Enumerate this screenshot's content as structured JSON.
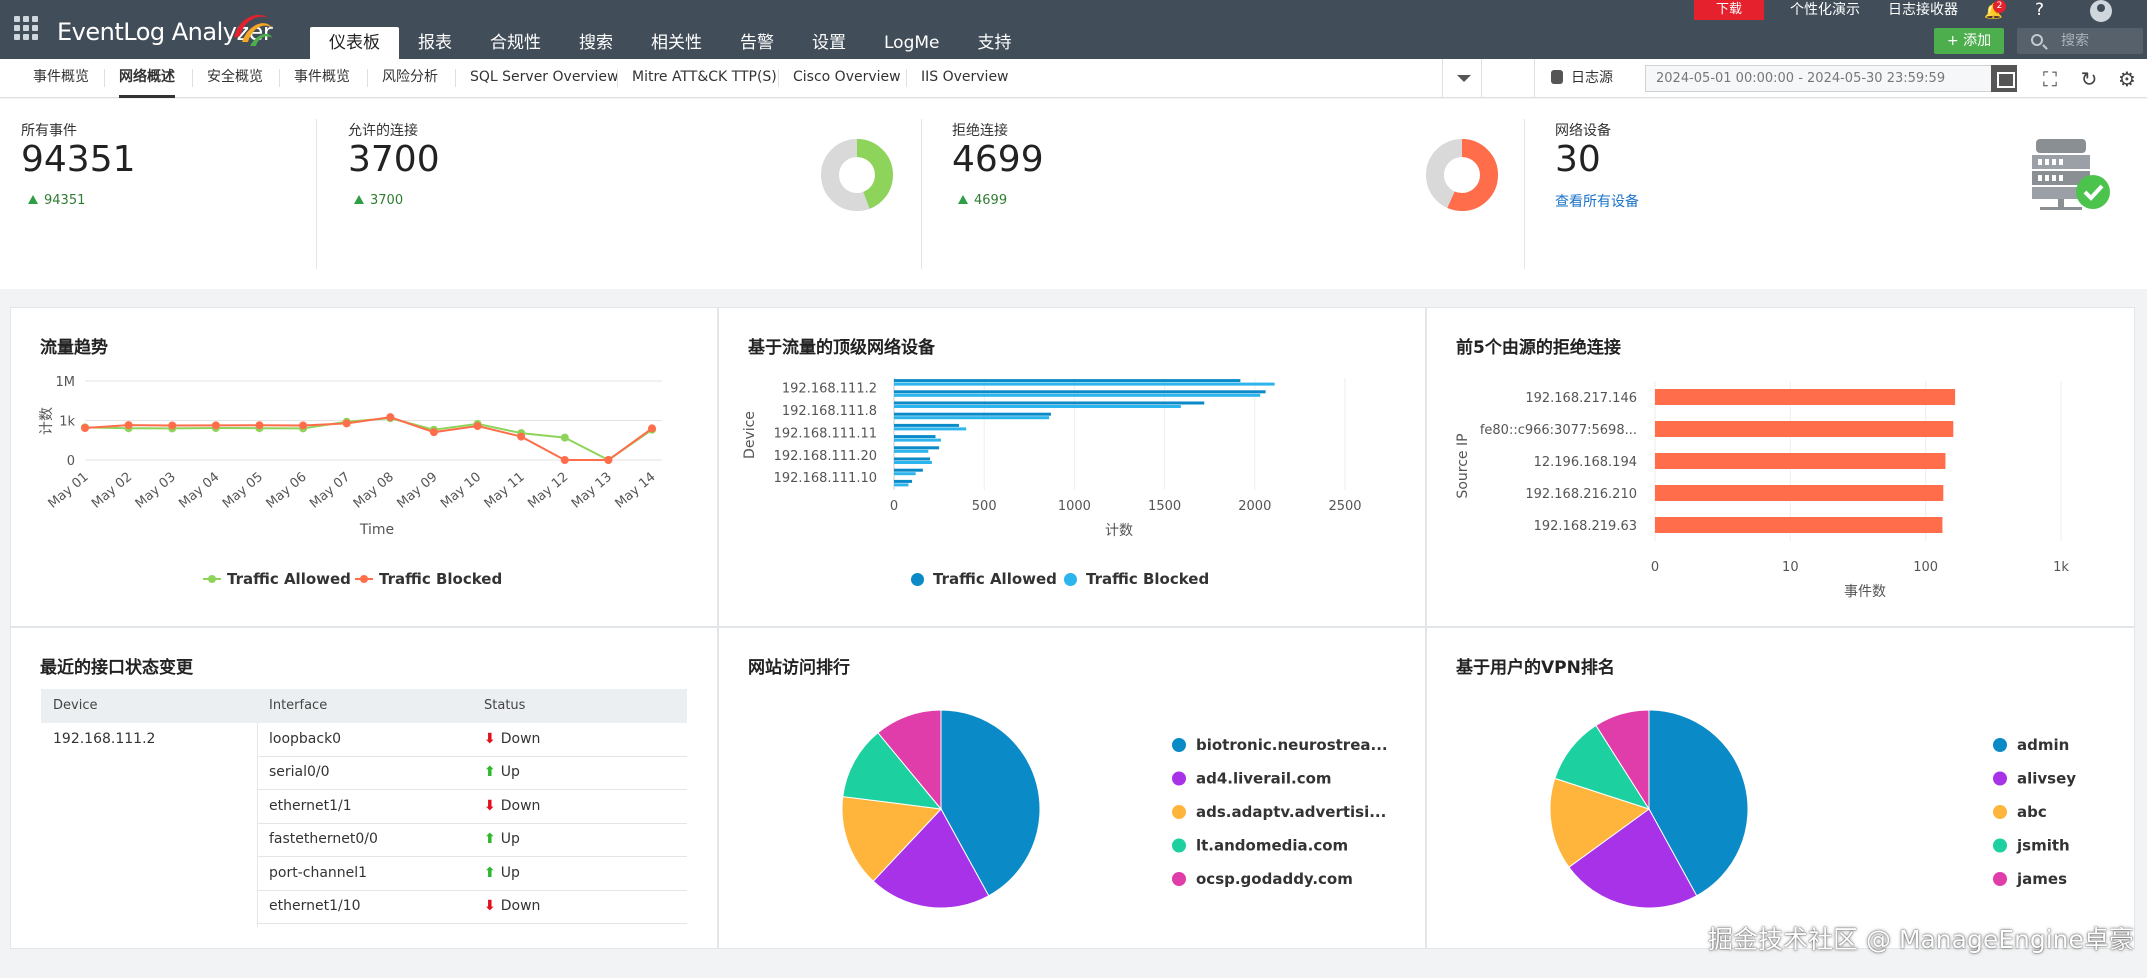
{
  "app": {
    "name": "EventLog Analyzer"
  },
  "nav": {
    "items": [
      "仪表板",
      "报表",
      "合规性",
      "搜索",
      "相关性",
      "告警",
      "设置",
      "LogMe",
      "支持"
    ],
    "active": "仪表板"
  },
  "top_links": {
    "download": "下载",
    "personalize": "个性化演示",
    "log_receiver": "日志接收器",
    "notif_count": "2",
    "help": "?",
    "add": "添加",
    "search_placeholder": "搜索"
  },
  "subnav": {
    "tabs": [
      "事件概览",
      "网络概述",
      "安全概览",
      "事件概览",
      "风险分析",
      "SQL Server Overview",
      "Mitre ATT&CK TTP(S)",
      "Cisco Overview",
      "IIS Overview"
    ],
    "active": "网络概述",
    "log_source": "日志源",
    "date_range": "2024-05-01 00:00:00 - 2024-05-30 23:59:59"
  },
  "summary": {
    "all_events": {
      "label": "所有事件",
      "value": "94351",
      "delta": "94351"
    },
    "allowed": {
      "label": "允许的连接",
      "value": "3700",
      "delta": "3700"
    },
    "denied": {
      "label": "拒绝连接",
      "value": "4699",
      "delta": "4699"
    },
    "devices": {
      "label": "网络设备",
      "value": "30",
      "link": "查看所有设备"
    }
  },
  "colors": {
    "allowed_green": "#8fd45a",
    "blocked_orange": "#ff6d4a",
    "blue_dark": "#0a8ac6",
    "blue_light": "#2bb5ec",
    "donut_gray": "#d9d9d9"
  },
  "panels": {
    "traffic_trend": {
      "title": "流量趋势"
    },
    "top_devices": {
      "title": "基于流量的顶级网络设备"
    },
    "top_denied": {
      "title": "前5个由源的拒绝连接"
    },
    "interface_changes": {
      "title": "最近的接口状态变更"
    },
    "web_ranking": {
      "title": "网站访问排行"
    },
    "vpn_ranking": {
      "title": "基于用户的VPN排名"
    }
  },
  "chart_data": [
    {
      "type": "line",
      "title": "流量趋势",
      "xlabel": "Time",
      "ylabel": "计数",
      "yscale": "log",
      "ytick_labels": [
        "0",
        "1k",
        "1M"
      ],
      "categories": [
        "May 01",
        "May 02",
        "May 03",
        "May 04",
        "May 05",
        "May 06",
        "May 07",
        "May 08",
        "May 09",
        "May 10",
        "May 11",
        "May 12",
        "May 13",
        "May 14"
      ],
      "series": [
        {
          "name": "Traffic Allowed",
          "values": [
            300,
            260,
            250,
            270,
            260,
            250,
            800,
            1500,
            200,
            550,
            110,
            50,
            1,
            200
          ]
        },
        {
          "name": "Traffic Blocked",
          "values": [
            270,
            450,
            420,
            430,
            440,
            420,
            600,
            1800,
            130,
            380,
            60,
            1,
            1,
            250
          ]
        }
      ],
      "legend": "bottom"
    },
    {
      "type": "bar",
      "orientation": "horizontal",
      "title": "基于流量的顶级网络设备",
      "ylabel": "Device",
      "xlabel": "计数",
      "xlim": [
        0,
        2500
      ],
      "xticks": [
        0,
        500,
        1000,
        1500,
        2000,
        2500
      ],
      "categories": [
        "192.168.111.2",
        "192.168.111.8",
        "192.168.111.11",
        "192.168.111.20",
        "192.168.111.10"
      ],
      "row_labels": [
        "192.168.111.2",
        "",
        "192.168.111.8",
        "",
        "192.168.111.11",
        "",
        "192.168.111.20",
        "",
        "192.168.111.10",
        ""
      ],
      "series": [
        {
          "name": "Traffic Allowed",
          "values": [
            1920,
            2060,
            1720,
            870,
            360,
            230,
            250,
            200,
            160,
            100
          ]
        },
        {
          "name": "Traffic Blocked",
          "values": [
            2110,
            2030,
            1590,
            860,
            400,
            260,
            190,
            210,
            120,
            80
          ]
        }
      ],
      "legend": "bottom"
    },
    {
      "type": "bar",
      "orientation": "horizontal",
      "title": "前5个由源的拒绝连接",
      "ylabel": "Source IP",
      "xlabel": "事件数",
      "xscale": "log",
      "xtick_labels": [
        "0",
        "10",
        "100",
        "1k"
      ],
      "categories": [
        "192.168.217.146",
        "fe80::c966:3077:5698...",
        "12.196.168.194",
        "192.168.216.210",
        "192.168.219.63"
      ],
      "values": [
        165,
        160,
        140,
        135,
        133
      ]
    },
    {
      "type": "table",
      "title": "最近的接口状态变更",
      "columns": [
        "Device",
        "Interface",
        "Status"
      ],
      "device": "192.168.111.2",
      "rows": [
        {
          "interface": "loopback0",
          "status": "Down"
        },
        {
          "interface": "serial0/0",
          "status": "Up"
        },
        {
          "interface": "ethernet1/1",
          "status": "Down"
        },
        {
          "interface": "fastethernet0/0",
          "status": "Up"
        },
        {
          "interface": "port-channel1",
          "status": "Up"
        },
        {
          "interface": "ethernet1/10",
          "status": "Down"
        }
      ]
    },
    {
      "type": "pie",
      "title": "网站访问排行",
      "labels": [
        "biotronic.neurostrea...",
        "ad4.liverail.com",
        "ads.adaptv.advertisi...",
        "lt.andomedia.com",
        "ocsp.godaddy.com"
      ],
      "values": [
        42,
        20,
        15,
        12,
        11
      ],
      "colors": [
        "#0a8ac6",
        "#a832e8",
        "#ffb43b",
        "#1dd0a0",
        "#e03caa"
      ]
    },
    {
      "type": "pie",
      "title": "基于用户的VPN排名",
      "labels": [
        "admin",
        "alivsey",
        "abc",
        "jsmith",
        "james"
      ],
      "values": [
        42,
        23,
        15,
        11,
        9
      ],
      "colors": [
        "#0a8ac6",
        "#a832e8",
        "#ffb43b",
        "#1dd0a0",
        "#e03caa"
      ]
    }
  ],
  "watermark": "掘金技术社区 @ ManageEngine卓豪"
}
